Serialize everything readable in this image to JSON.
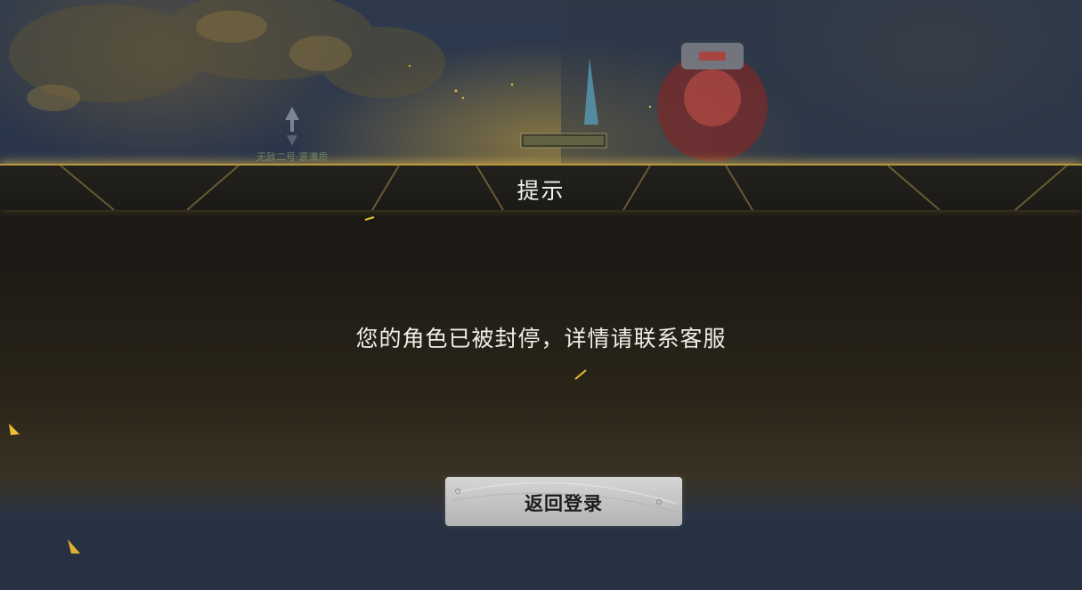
{
  "dialog": {
    "title": "提示",
    "message": "您的角色已被封停，详情请联系客服",
    "return_button_label": "返回登录"
  },
  "scene": {
    "npc_nameplate": "无敌二号·寰瀵质"
  },
  "colors": {
    "accent_gold": "#b99a3e",
    "dialog_bg": "#1c1a17",
    "button_bg": "#c8c8c8",
    "text_light": "#f2f0ea"
  }
}
